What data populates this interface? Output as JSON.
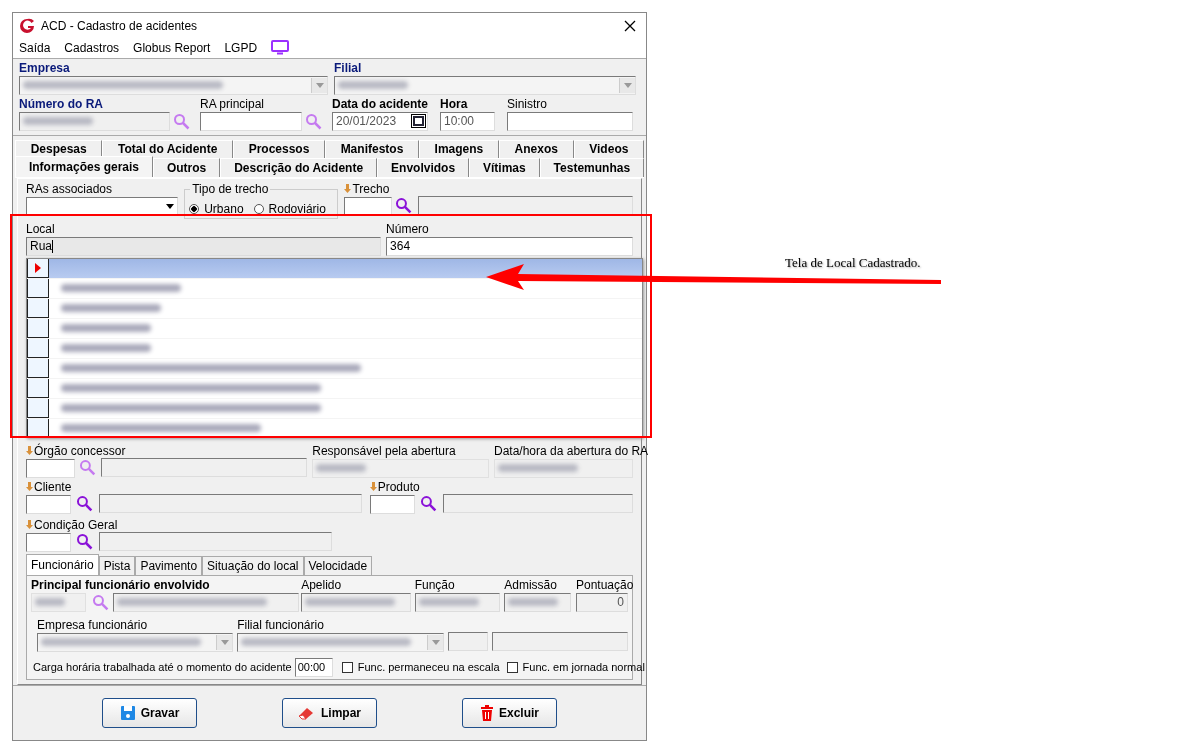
{
  "window": {
    "title": "ACD - Cadastro de acidentes"
  },
  "menu": [
    "Saída",
    "Cadastros",
    "Globus Report",
    "LGPD"
  ],
  "header": {
    "empresa": {
      "label": "Empresa",
      "kind": "required"
    },
    "filial": {
      "label": "Filial",
      "kind": "required"
    },
    "numero_ra": {
      "label": "Número do RA",
      "kind": "required"
    },
    "ra_principal": {
      "label": "RA principal"
    },
    "data_acidente": {
      "label": "Data do acidente",
      "kind": "bold",
      "value": "20/01/2023"
    },
    "hora": {
      "label": "Hora",
      "kind": "bold",
      "value": "10:00"
    },
    "sinistro": {
      "label": "Sinistro"
    }
  },
  "tabs_row_1": [
    {
      "label": "Despesas",
      "selected": false
    },
    {
      "label": "Total do Acidente",
      "selected": false
    },
    {
      "label": "Processos",
      "selected": false
    },
    {
      "label": "Manifestos",
      "selected": false
    },
    {
      "label": "Imagens",
      "selected": false
    },
    {
      "label": "Anexos",
      "selected": false
    },
    {
      "label": "Videos",
      "selected": false
    }
  ],
  "tabs_row_2": [
    {
      "label": "Informações gerais",
      "selected": true
    },
    {
      "label": "Outros",
      "selected": false
    },
    {
      "label": "Descrição do Acidente",
      "selected": false
    },
    {
      "label": "Envolvidos",
      "selected": false
    },
    {
      "label": "Vítimas",
      "selected": false
    },
    {
      "label": "Testemunhas",
      "selected": false
    }
  ],
  "ras_associados": {
    "label": "RAs associados"
  },
  "tipo_trecho": {
    "label": "Tipo de trecho",
    "options": [
      {
        "label": "Urbano",
        "selected": true
      },
      {
        "label": "Rodoviário",
        "selected": false
      }
    ]
  },
  "trecho": {
    "label": "Trecho"
  },
  "local": {
    "label": "Local",
    "value": "Rua"
  },
  "numero": {
    "label": "Número",
    "value": "364"
  },
  "local_list": {
    "rows": [
      {
        "selected": true
      },
      {
        "selected": false
      },
      {
        "selected": false
      },
      {
        "selected": false
      },
      {
        "selected": false
      },
      {
        "selected": false
      },
      {
        "selected": false
      },
      {
        "selected": false
      },
      {
        "selected": false
      }
    ]
  },
  "orgao": {
    "label": "Órgão concessor"
  },
  "responsavel": {
    "label": "Responsável pela abertura"
  },
  "data_abertura": {
    "label": "Data/hora da abertura do RA"
  },
  "cliente": {
    "label": "Cliente"
  },
  "produto": {
    "label": "Produto"
  },
  "condicao": {
    "label": "Condição Geral"
  },
  "subtabs": [
    {
      "label": "Funcionário",
      "selected": true
    },
    {
      "label": "Pista",
      "selected": false
    },
    {
      "label": "Pavimento",
      "selected": false
    },
    {
      "label": "Situação do local",
      "selected": false
    },
    {
      "label": "Velocidade",
      "selected": false
    }
  ],
  "funcionario": {
    "principal": "Principal funcionário envolvido",
    "apelido": "Apelido",
    "funcao": "Função",
    "admissao": "Admissão",
    "pontuacao": {
      "label": "Pontuação",
      "value": "0"
    },
    "empresa": "Empresa funcionário",
    "filial": "Filial funcionário",
    "carga": {
      "label": "Carga horária trabalhada até o momento do acidente",
      "value": "00:00"
    },
    "checks": [
      {
        "label": "Func. permaneceu na escala",
        "checked": false
      },
      {
        "label": "Func. em jornada normal",
        "checked": false
      }
    ]
  },
  "buttons": [
    {
      "label": "Gravar",
      "kind": "save"
    },
    {
      "label": "Limpar",
      "kind": "clear"
    },
    {
      "label": "Excluir",
      "kind": "delete"
    }
  ],
  "annotation": "Tela de Local Cadastrado."
}
